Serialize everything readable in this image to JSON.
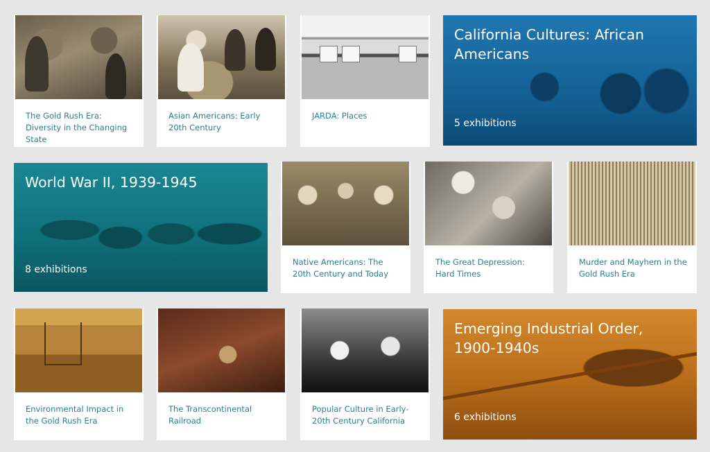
{
  "cards": {
    "gold_rush_diversity": {
      "caption": "The Gold Rush Era: Diversity in the Changing State"
    },
    "asian_americans": {
      "caption": "Asian Americans: Early 20th Century"
    },
    "jarda_places": {
      "caption": "JARDA: Places"
    },
    "native_americans": {
      "caption": "Native Americans: The 20th Century and Today"
    },
    "great_depression": {
      "caption": "The Great Depression: Hard Times"
    },
    "murder_mayhem": {
      "caption": "Murder and Mayhem in the Gold Rush Era"
    },
    "environmental_impact": {
      "caption": "Environmental Impact in the Gold Rush Era"
    },
    "transcontinental_railroad": {
      "caption": "The Transcontinental Railroad"
    },
    "popular_culture": {
      "caption": "Popular Culture in Early-20th Century California"
    }
  },
  "features": {
    "african_americans": {
      "title": "California Cultures: African Americans",
      "count": "5 exhibitions",
      "color": "#1f6fa4"
    },
    "world_war_ii": {
      "title": "World War II, 1939-1945",
      "count": "8 exhibitions",
      "color": "#137a86"
    },
    "industrial_order": {
      "title": "Emerging Industrial Order, 1900-1940s",
      "count": "6 exhibitions",
      "color": "#c8761b"
    }
  },
  "icons": [
    "photo-thumbnail"
  ]
}
